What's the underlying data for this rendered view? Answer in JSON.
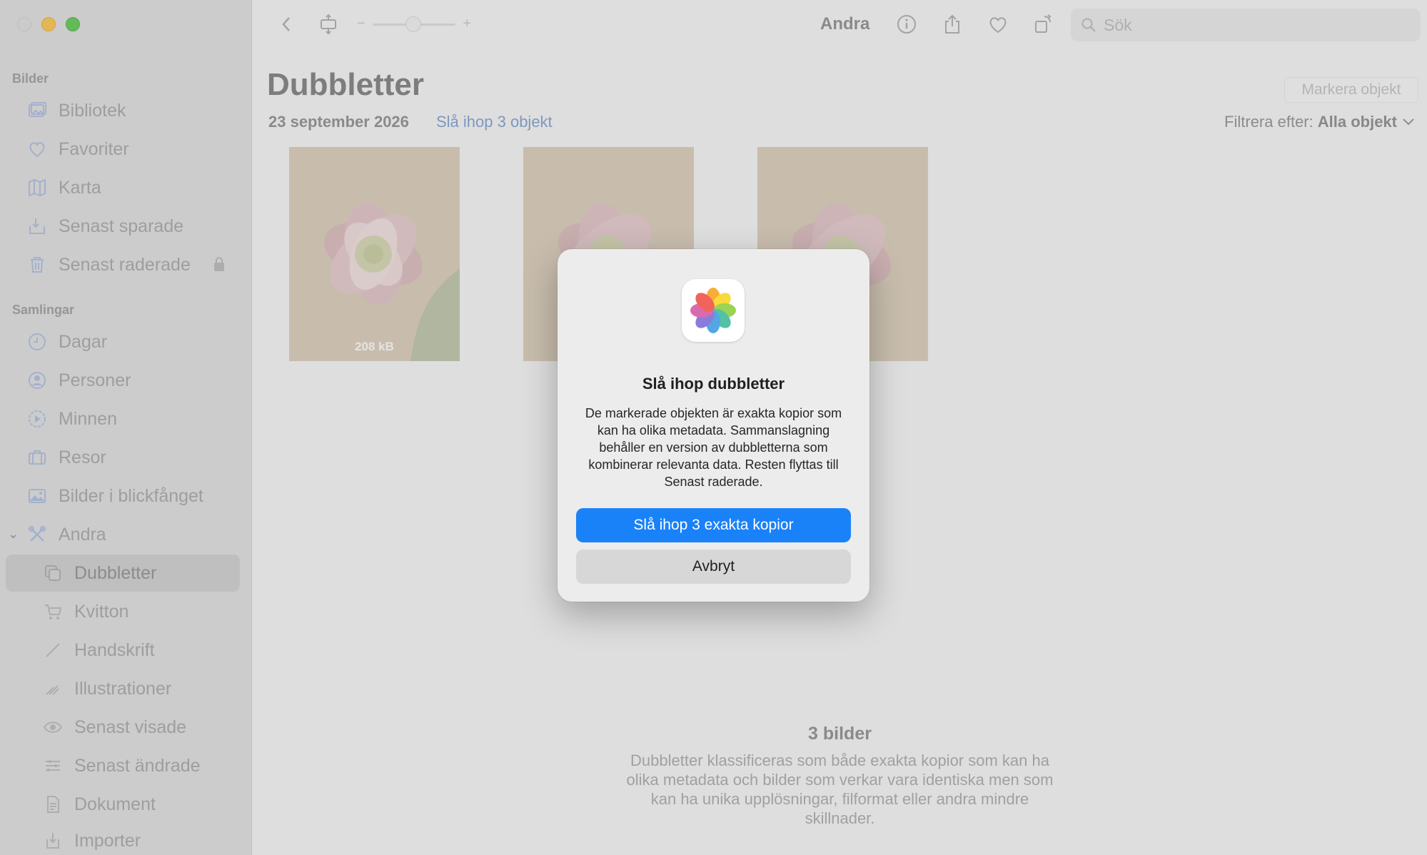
{
  "sidebar": {
    "section_photos": "Bilder",
    "section_collections": "Samlingar",
    "library": "Bibliotek",
    "favorites": "Favoriter",
    "map": "Karta",
    "recently_saved": "Senast sparade",
    "recently_deleted": "Senast raderade",
    "days": "Dagar",
    "people": "Personer",
    "memories": "Minnen",
    "trips": "Resor",
    "featured": "Bilder i blickfånget",
    "other": "Andra",
    "duplicates": "Dubbletter",
    "receipts": "Kvitton",
    "handwriting": "Handskrift",
    "illustrations": "Illustrationer",
    "recently_viewed": "Senast visade",
    "recently_edited": "Senast ändrade",
    "documents": "Dokument",
    "imports": "Importer"
  },
  "toolbar": {
    "title": "Andra",
    "search_placeholder": "Sök",
    "zoom_minus": "−",
    "zoom_plus": "+"
  },
  "main": {
    "title": "Dubbletter",
    "date": "23 september 2026",
    "merge_link": "Slå ihop 3 objekt",
    "select_button": "Markera objekt",
    "filter_label": "Filtrera efter:",
    "filter_value": "Alla objekt",
    "photo_size": "208 kB",
    "footer_title": "3 bilder",
    "footer_text": "Dubbletter klassificeras som både exakta kopior som kan ha olika metadata och bilder som verkar vara identiska men som kan ha unika upplösningar, filformat eller andra mindre skillnader."
  },
  "dialog": {
    "title": "Slå ihop dubbletter",
    "message": "De markerade objekten är exakta kopior som kan ha olika metadata. Sammanslagning behåller en version av dubbletterna som kombinerar relevanta data. Resten flyttas till Senast raderade.",
    "primary": "Slå ihop 3 exakta kopior",
    "secondary": "Avbryt"
  },
  "colors": {
    "accent": "#1a82f8",
    "link": "#7d9cc8"
  }
}
